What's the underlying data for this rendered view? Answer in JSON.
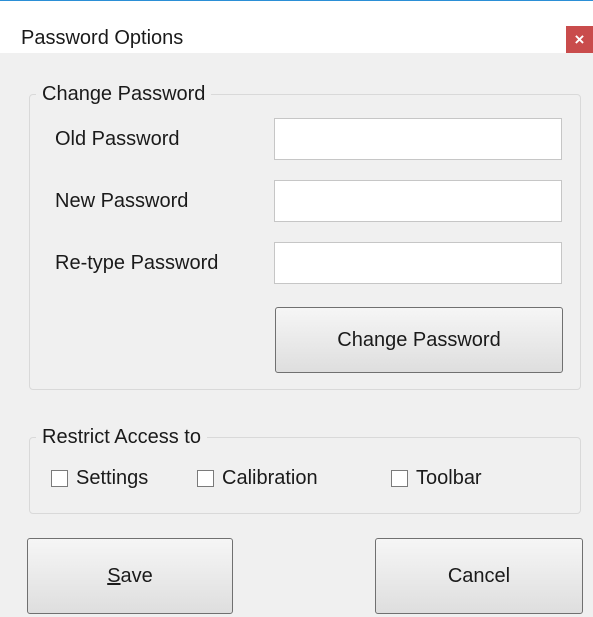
{
  "window": {
    "title": "Password Options",
    "close_glyph": "×"
  },
  "change_password": {
    "legend": "Change Password",
    "old_label": "Old Password",
    "new_label": "New Password",
    "retype_label": "Re-type Password",
    "old_value": "",
    "new_value": "",
    "retype_value": "",
    "button_label": "Change Password"
  },
  "restrict": {
    "legend": "Restrict Access to",
    "settings_label": "Settings",
    "calibration_label": "Calibration",
    "toolbar_label": "Toolbar",
    "settings_checked": false,
    "calibration_checked": false,
    "toolbar_checked": false
  },
  "buttons": {
    "save_mnemonic": "S",
    "save_rest": "ave",
    "cancel_label": "Cancel"
  },
  "colors": {
    "accent_border": "#2b8fd6",
    "close_bg": "#c94c4c",
    "client_bg": "#f0f0f0"
  }
}
